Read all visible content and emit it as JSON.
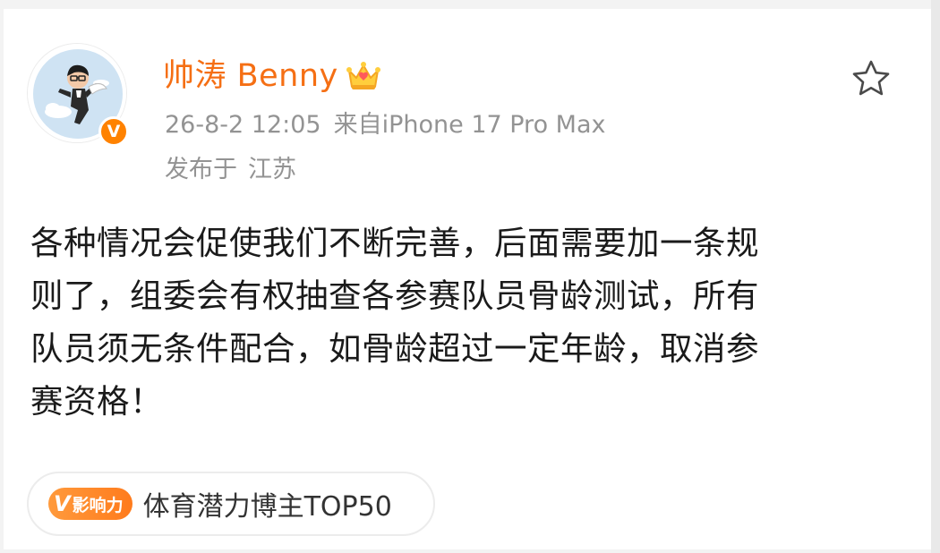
{
  "post": {
    "author": {
      "name": "帅涛 Benny",
      "verified_mark": "V",
      "member_badge_icon": "crown-icon"
    },
    "meta": {
      "time": "26-8-2 12:05",
      "source": "来自iPhone 17 Pro Max",
      "location_prefix": "发布于",
      "location": "江苏"
    },
    "body_lines": [
      "各种情况会促使我们不断完善，后面需要加一条规",
      "则了，组委会有权抽查各参赛队员骨龄测试，所有",
      "队员须无条件配合，如骨龄超过一定年龄，取消参",
      "赛资格！"
    ],
    "influence": {
      "badge_v": "V",
      "badge_label": "影响力",
      "text": "体育潜力博主TOP50"
    },
    "actions": {
      "favorite_icon": "star-icon"
    }
  },
  "colors": {
    "author_name": "#f56f14",
    "verified_badge": "#ff8200",
    "meta_text": "#939393",
    "body_text": "#1a1a1a",
    "influence_badge": "#ff8a2a"
  }
}
